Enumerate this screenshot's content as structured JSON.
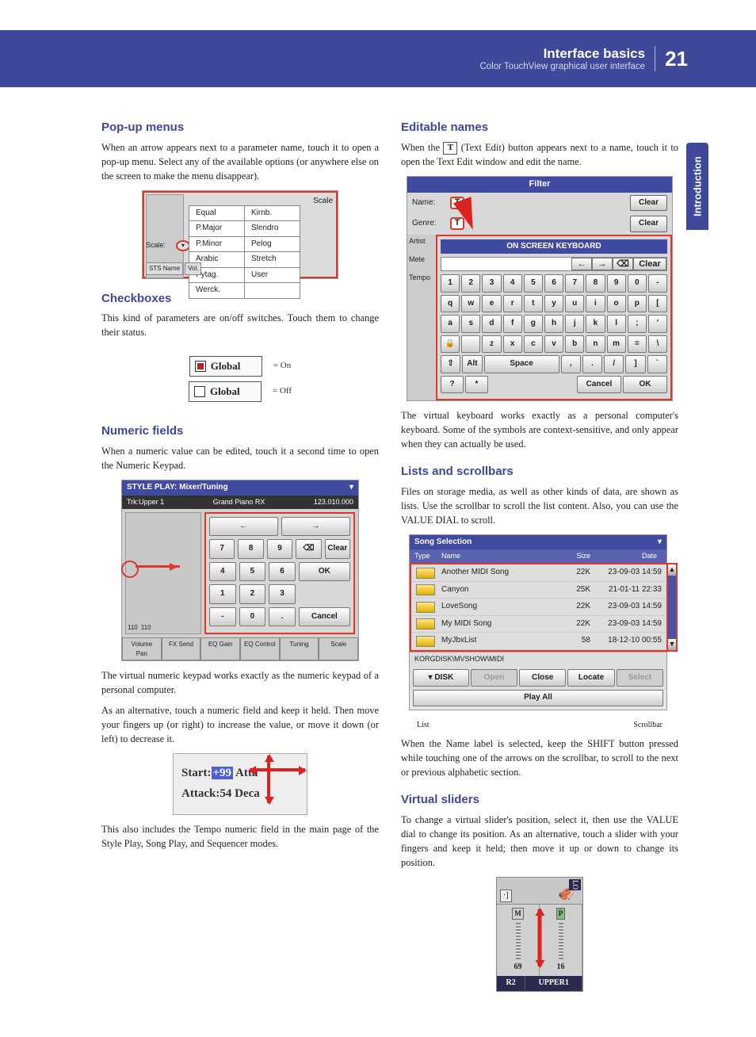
{
  "header": {
    "title": "Interface basics",
    "subtitle": "Color TouchView graphical user interface",
    "page": "21"
  },
  "side_tab": "Introduction",
  "left": {
    "popup": {
      "h": "Pop-up menus",
      "p": "When an arrow appears next to a parameter name, touch it to open a pop-up menu. Select any of the available options (or anywhere else on the screen to make the menu disappear).",
      "scale_lbl": "Scale",
      "scale_side": "Scale:",
      "sts": "STS Name",
      "rows": [
        [
          "Equal",
          "Kirnb."
        ],
        [
          "P.Major",
          "Slendro"
        ],
        [
          "P.Minor",
          "Pelog"
        ],
        [
          "Arabic",
          "Stretch"
        ],
        [
          "Pytag.",
          "User"
        ],
        [
          "Werck.",
          ""
        ]
      ]
    },
    "cb": {
      "h": "Checkboxes",
      "p": "This kind of parameters are on/off switches. Touch them to change their status.",
      "label": "Global",
      "on": "= On",
      "off": "= Off"
    },
    "num": {
      "h": "Numeric fields",
      "p1": "When a numeric value can be edited, touch it a second time to open the Numeric Keypad.",
      "title": "STYLE PLAY: Mixer/Tuning",
      "sub_l": "Trk:Upper 1",
      "sub_m": "Grand Piano RX",
      "tabs": [
        "Volume Pan",
        "FX Send",
        "EQ Gain",
        "EQ Control",
        "Tuning",
        "Scale"
      ],
      "p2": "The virtual numeric keypad works exactly as the numeric keypad of a personal computer.",
      "p3": "As an alternative, touch a numeric field and keep it held. Then move your fingers up (or right) to increase the value, or move it down (or left) to decrease it.",
      "drag_l1a": "Start:",
      "drag_l1b": "+99",
      "drag_l1c": "Atta",
      "drag_l2a": "Attack:",
      "drag_l2b": "54",
      "drag_l2c": "Deca",
      "p4": "This also includes the Tempo numeric field in the main page of the Style Play, Song Play, and Sequencer modes.",
      "keys": {
        "r0": [
          "←",
          "→"
        ],
        "r1": [
          "7",
          "8",
          "9"
        ],
        "r1b": [
          "⌫",
          "Clear"
        ],
        "r2": [
          "4",
          "5",
          "6"
        ],
        "r3": [
          "1",
          "2",
          "3"
        ],
        "r4": [
          "-",
          "0",
          "."
        ],
        "ok": "OK",
        "cancel": "Cancel"
      }
    }
  },
  "right": {
    "edit": {
      "h": "Editable names",
      "p1a": "When the ",
      "p1b": " (Text Edit) button appears next to a name, touch it to open the Text Edit window and edit the name.",
      "t": "T",
      "filter_title": "Filter",
      "rows_lbl": [
        "Name:",
        "Genre:",
        "Artist",
        "Mete",
        "Tempo"
      ],
      "clear": "Clear",
      "osk": "ON SCREEN KEYBOARD",
      "nav": [
        "←",
        "→",
        "⌫",
        "Clear"
      ],
      "k1": [
        "1",
        "2",
        "3",
        "4",
        "5",
        "6",
        "7",
        "8",
        "9",
        "0",
        "-"
      ],
      "k2": [
        "q",
        "w",
        "e",
        "r",
        "t",
        "y",
        "u",
        "i",
        "o",
        "p",
        "["
      ],
      "k3": [
        "a",
        "s",
        "d",
        "f",
        "g",
        "h",
        "j",
        "k",
        "l",
        ";",
        "'"
      ],
      "k4": [
        "🔒",
        "",
        "z",
        "x",
        "c",
        "v",
        "b",
        "n",
        "m",
        "=",
        "\\"
      ],
      "k5": [
        "⇧",
        "Alt",
        "Space",
        ",",
        ".",
        "/",
        "]",
        "`"
      ],
      "k6": [
        "?",
        "*"
      ],
      "cancel": "Cancel",
      "ok": "OK",
      "p2": "The virtual keyboard works exactly as a personal computer's keyboard. Some of the symbols are context-sensitive, and only appear when they can actually be used."
    },
    "list": {
      "h": "Lists and scrollbars",
      "p1": "Files on storage media, as well as other kinds of data, are shown as lists. Use the scrollbar to scroll the list content. Also, you can use the VALUE DIAL to scroll.",
      "title": "Song Selection",
      "cols": [
        "Type",
        "Name",
        "Size",
        "Date"
      ],
      "rows": [
        {
          "name": "Another MIDI Song",
          "size": "22K",
          "date": "23-09-03 14:59"
        },
        {
          "name": "Canyon",
          "size": "25K",
          "date": "21-01-11 22:33"
        },
        {
          "name": "LoveSong",
          "size": "22K",
          "date": "23-09-03 14:59"
        },
        {
          "name": "My MIDI Song",
          "size": "22K",
          "date": "23-09-03 14:59"
        },
        {
          "name": "MyJbxList",
          "size": "58",
          "date": "18-12-10 00:55"
        }
      ],
      "path": "KORGDISK\\MVSHOW\\MIDI",
      "btns": [
        "DISK",
        "Open",
        "Close",
        "Locate",
        "Select"
      ],
      "playall": "Play All",
      "cap_l": "List",
      "cap_r": "Scrollbar",
      "p2": "When the Name label is selected, keep the SHIFT button pressed while touching one of the arrows on the scrollbar, to scroll to the next or previous alphabetic section."
    },
    "sld": {
      "h": "Virtual sliders",
      "p": "To change a virtual slider's position, select it, then use the VALUE dial to change its position. As an alternative, touch a slider with your fingers and keep it held; then move it up or down to change its position.",
      "top_m": "M",
      "top_p": "P",
      "v1": "69",
      "v2": "16",
      "b1": "R2",
      "b2": "UPPER1"
    }
  }
}
